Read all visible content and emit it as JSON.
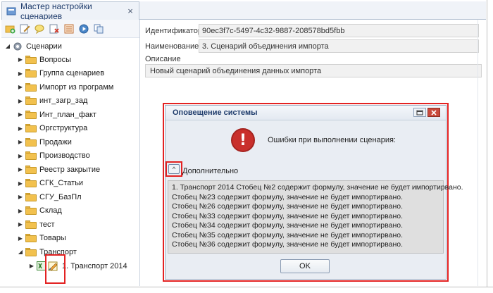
{
  "tab": {
    "title": "Мастер настройки сценариев",
    "close_glyph": "×",
    "icon": "wizard-icon"
  },
  "toolbar": {
    "buttons": [
      {
        "icon": "add-folder-icon"
      },
      {
        "icon": "edit-icon"
      },
      {
        "icon": "comment-icon"
      },
      {
        "icon": "delete-icon"
      },
      {
        "icon": "properties-icon"
      },
      {
        "icon": "run-icon"
      },
      {
        "icon": "copy-icon"
      }
    ]
  },
  "tree": {
    "root": "Сценарии",
    "items": [
      "Вопросы",
      "Группа сценариев",
      "Импорт из программ",
      "инт_загр_зад",
      "Инт_план_факт",
      "Оргструктура",
      "Продажи",
      "Производство",
      "Реестр закрытие",
      "СГК_Статьи",
      "СГУ_БазПл",
      "Склад",
      "тест",
      "Товары",
      "Транспорт"
    ],
    "child": "1. Транспорт 2014"
  },
  "form": {
    "id_label": "Идентификатор",
    "id_value": "90ec3f7c-5497-4c32-9887-208578bd5fbb",
    "name_label": "Наименование",
    "name_value": "3. Сценарий объединения импорта",
    "desc_label": "Описание",
    "desc_value": "Новый сценарий объединения данных импорта"
  },
  "dialog": {
    "title": "Оповещение системы",
    "message": "Ошибки при выполнении сценария:",
    "expander_label": "Дополнительно",
    "details": [
      "1. Транспорт 2014 Стобец №2 содержит формулу, значение не будет импортирвано.",
      "Стобец №23 содержит формулу, значение не будет импортирвано.",
      "Стобец №26 содержит формулу, значение не будет импортирвано.",
      "Стобец №33 содержит формулу, значение не будет импортирвано.",
      "Стобец №34 содержит формулу, значение не будет импортирвано.",
      "Стобец №35 содержит формулу, значение не будет импортирвано.",
      "Стобец №36 содержит формулу, значение не будет импортирвано."
    ],
    "ok_label": "OK",
    "error_glyph": "!",
    "collapse_glyph": "^"
  },
  "colors": {
    "highlight": "#e32222",
    "folder": "#f2c14e",
    "error": "#c9302c"
  }
}
